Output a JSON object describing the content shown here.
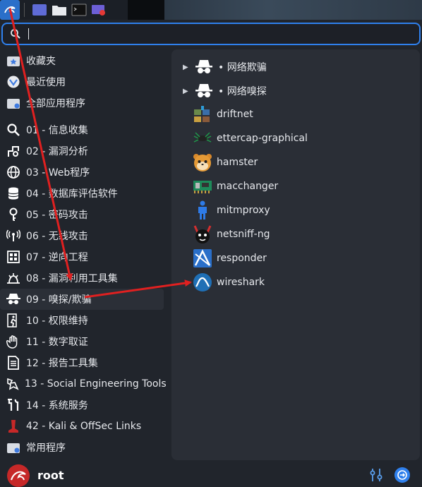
{
  "taskbar": {
    "items": [
      "kali-menu",
      "workspace",
      "files",
      "terminal",
      "screen-recorder"
    ]
  },
  "search": {
    "value": ""
  },
  "sidebar": {
    "items": [
      {
        "label": "收藏夹",
        "icon": "star-folder-icon"
      },
      {
        "label": "最近使用",
        "icon": "recent-icon"
      },
      {
        "label": "全部应用程序",
        "icon": "all-apps-icon"
      },
      {
        "label": "01 - 信息收集",
        "icon": "magnifier-icon"
      },
      {
        "label": "02 - 漏洞分析",
        "icon": "vuln-analysis-icon"
      },
      {
        "label": "03 - Web程序",
        "icon": "globe-icon"
      },
      {
        "label": "04 - 数据库评估软件",
        "icon": "database-icon"
      },
      {
        "label": "05 - 密码攻击",
        "icon": "key-icon"
      },
      {
        "label": "06 - 无线攻击",
        "icon": "wireless-icon"
      },
      {
        "label": "07 - 逆向工程",
        "icon": "chip-icon"
      },
      {
        "label": "08 - 漏洞利用工具集",
        "icon": "exploit-icon"
      },
      {
        "label": "09 - 嗅探/欺骗",
        "icon": "spy-icon"
      },
      {
        "label": "10 - 权限维持",
        "icon": "escape-icon"
      },
      {
        "label": "11 - 数字取证",
        "icon": "hand-icon"
      },
      {
        "label": "12 - 报告工具集",
        "icon": "report-icon"
      },
      {
        "label": "13 - Social Engineering Tools",
        "icon": "social-eng-icon"
      },
      {
        "label": "14 - 系统服务",
        "icon": "tools-icon"
      },
      {
        "label": "42 - Kali & OffSec Links",
        "icon": "kali-links-icon"
      },
      {
        "label": "常用程序",
        "icon": "common-apps-icon"
      }
    ]
  },
  "panel": {
    "items": [
      {
        "label": "• 网络欺骗",
        "icon": "spy-icon",
        "expandable": true
      },
      {
        "label": "• 网络嗅探",
        "icon": "spy-icon",
        "expandable": true
      },
      {
        "label": "driftnet",
        "icon": "driftnet-icon"
      },
      {
        "label": "ettercap-graphical",
        "icon": "ettercap-icon"
      },
      {
        "label": "hamster",
        "icon": "hamster-icon"
      },
      {
        "label": "macchanger",
        "icon": "macchanger-icon"
      },
      {
        "label": "mitmproxy",
        "icon": "mitmproxy-icon"
      },
      {
        "label": "netsniff-ng",
        "icon": "netsniff-icon"
      },
      {
        "label": "responder",
        "icon": "responder-icon"
      },
      {
        "label": "wireshark",
        "icon": "wireshark-icon"
      }
    ]
  },
  "user": {
    "name": "root"
  },
  "colors": {
    "accent": "#2f80ed",
    "annotation_arrow": "#e02020",
    "panel_bg": "#2a2e36",
    "menu_bg": "#21252c"
  }
}
